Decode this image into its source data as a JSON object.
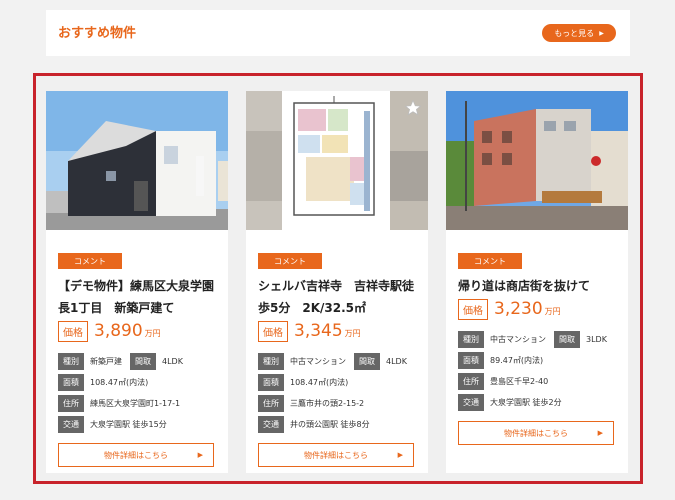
{
  "header": {
    "title": "おすすめ物件",
    "more_label": "もっと見る"
  },
  "cards": [
    {
      "tag": "コメント",
      "title": "【デモ物件】練馬区大泉学園長1丁目　新築戸建て",
      "price_label": "価格",
      "price": "3,890",
      "unit": "万円",
      "specs": {
        "type_label": "種別",
        "type": "新築戸建",
        "layout_label": "間取",
        "layout": "4LDK",
        "area_label": "面積",
        "area": "108.47㎡(内法)",
        "address_label": "住所",
        "address": "練馬区大泉学園町1-17-1",
        "access_label": "交通",
        "access": "大泉学園駅 徒歩15分"
      },
      "detail_label": "物件詳細はこちら"
    },
    {
      "tag": "コメント",
      "title": "シェルバ吉祥寺　吉祥寺駅徒歩5分　2K/32.5㎡",
      "price_label": "価格",
      "price": "3,345",
      "unit": "万円",
      "specs": {
        "type_label": "種別",
        "type": "中古マンション",
        "layout_label": "間取",
        "layout": "4LDK",
        "area_label": "面積",
        "area": "108.47㎡(内法)",
        "address_label": "住所",
        "address": "三鷹市井の頭2-15-2",
        "access_label": "交通",
        "access": "井の頭公園駅 徒歩8分"
      },
      "detail_label": "物件詳細はこちら"
    },
    {
      "tag": "コメント",
      "title": "帰り道は商店街を抜けて",
      "price_label": "価格",
      "price": "3,230",
      "unit": "万円",
      "specs": {
        "type_label": "種別",
        "type": "中古マンション",
        "layout_label": "間取",
        "layout": "3LDK",
        "area_label": "面積",
        "area": "89.47㎡(内法)",
        "address_label": "住所",
        "address": "豊島区千早2-40",
        "access_label": "交通",
        "access": "大泉学園駅 徒歩2分"
      },
      "detail_label": "物件詳細はこちら"
    }
  ],
  "colors": {
    "accent": "#e8671c",
    "highlight_border": "#c8232b",
    "label_bg": "#666666"
  },
  "icons": {
    "more": "chevron-right-icon",
    "favorite": "star-icon"
  }
}
